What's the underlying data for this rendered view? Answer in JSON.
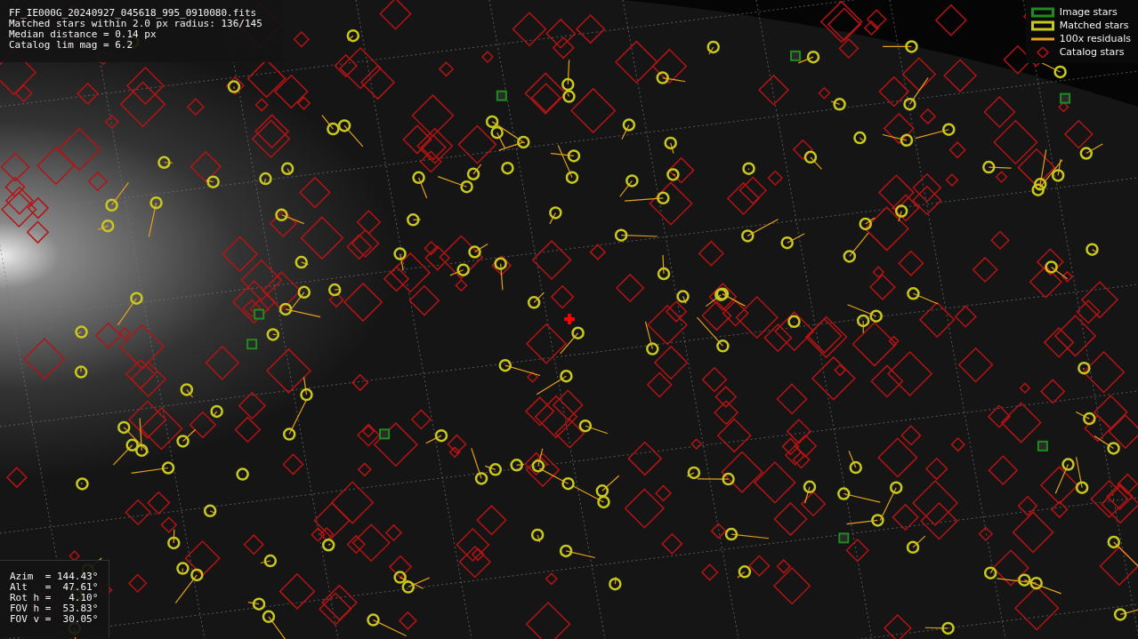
{
  "info_panel": {
    "lines": [
      "FF_IE000G_20240927_045618_995_0910080.fits",
      "Matched stars within 2.0 px radius: 136/145",
      "Median distance = 0.14 px",
      "Catalog lim mag = 6.2"
    ]
  },
  "legend": {
    "items": [
      {
        "kind": "box",
        "color": "#1e8c1e",
        "label": "Image stars"
      },
      {
        "kind": "box",
        "color": "#c8c81e",
        "label": "Matched stars"
      },
      {
        "kind": "line",
        "color": "#e6a01e",
        "label": "100x residuals"
      },
      {
        "kind": "diamond",
        "color": "#b41414",
        "label": "Catalog stars"
      }
    ]
  },
  "pointing_panel": {
    "lines": [
      "Azim  = 144.43°",
      "Alt   =  47.61°",
      "Rot h =   4.10°",
      "FOV h =  53.83°",
      "FOV v =  30.05°"
    ]
  }
}
